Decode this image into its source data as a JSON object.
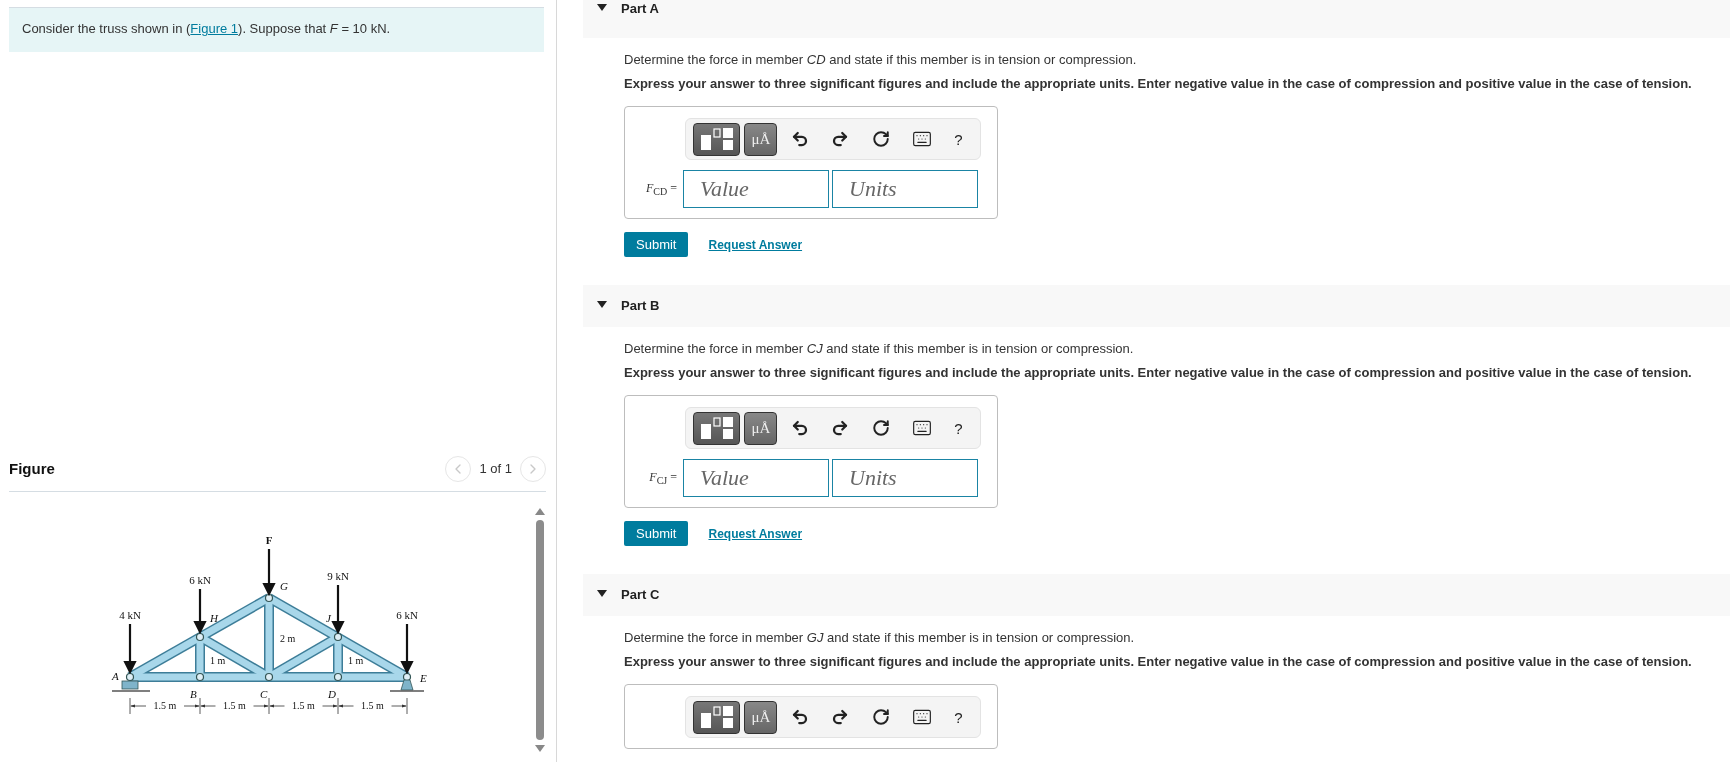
{
  "intro": {
    "before": "Consider the truss shown in (",
    "link": "Figure 1",
    "after": "). Suppose that *F* = 10 kN."
  },
  "figure": {
    "title": "Figure",
    "pager": "1 of 1",
    "nav": [
      {
        "kind": "prev",
        "disabled": true
      },
      {
        "kind": "next",
        "disabled": true
      }
    ],
    "loads": [
      "4 kN",
      "6 kN",
      "F",
      "9 kN",
      "6 kN"
    ],
    "joints": [
      "A",
      "H",
      "G",
      "J",
      "E",
      "B",
      "C",
      "D"
    ],
    "heights": [
      "2 m",
      "1 m",
      "1 m"
    ],
    "spans": [
      "1.5 m",
      "1.5 m",
      "1.5 m",
      "1.5 m"
    ]
  },
  "parts": [
    {
      "title": "Part A",
      "expanded": true,
      "question": "Determine the force in member *CD* and state if this member is in tension or compression.",
      "instruction": "Express your answer to three significant figures and include the appropriate units. Enter negative value in the case of compression and positive value in the case of tension.",
      "toolbar": {
        "units_button": "μÅ",
        "help": "?"
      },
      "label": "*F*$_{CD}$ =",
      "value_placeholder": "Value",
      "units_placeholder": "Units",
      "submit": "Submit",
      "request": "Request Answer"
    },
    {
      "title": "Part B",
      "expanded": true,
      "question": "Determine the force in member *CJ* and state if this member is in tension or compression.",
      "instruction": "Express your answer to three significant figures and include the appropriate units. Enter negative value in the case of compression and positive value in the case of tension.",
      "toolbar": {
        "units_button": "μÅ",
        "help": "?"
      },
      "label": "*F*$_{CJ}$ =",
      "value_placeholder": "Value",
      "units_placeholder": "Units",
      "submit": "Submit",
      "request": "Request Answer"
    },
    {
      "title": "Part C",
      "expanded": true,
      "question": "Determine the force in member *GJ* and state if this member is in tension or compression.",
      "instruction": "Express your answer to three significant figures and include the appropriate units. Enter negative value in the case of compression and positive value in the case of tension.",
      "toolbar": {
        "units_button": "μÅ",
        "help": "?"
      }
    }
  ]
}
